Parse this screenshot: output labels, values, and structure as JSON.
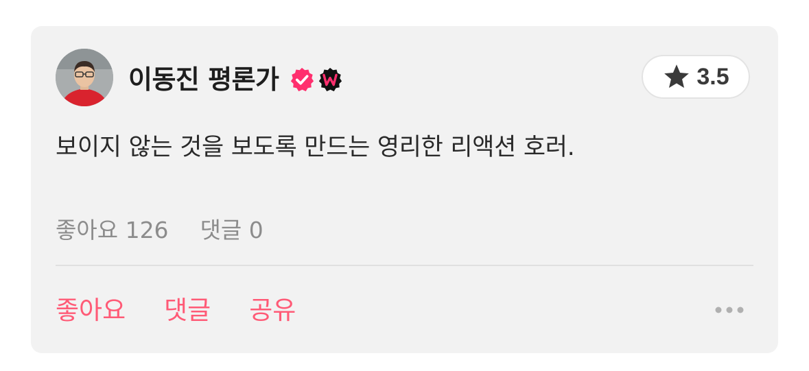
{
  "review": {
    "author": "이동진 평론가",
    "rating": "3.5",
    "comment": "보이지 않는 것을 보도록 만드는 영리한 리액션 호러.",
    "likes_text": "좋아요 126",
    "comments_text": "댓글 0"
  },
  "actions": {
    "like_label": "좋아요",
    "comment_label": "댓글",
    "share_label": "공유"
  },
  "icons": {
    "avatar": "user-avatar",
    "verified": "verified-badge-icon",
    "watcha": "watcha-w-badge-icon",
    "star": "star-icon",
    "more": "more-horizontal-icon"
  },
  "colors": {
    "accent": "#ff5a76",
    "verified": "#ff2f6e",
    "card_bg": "#f2f2f2"
  }
}
